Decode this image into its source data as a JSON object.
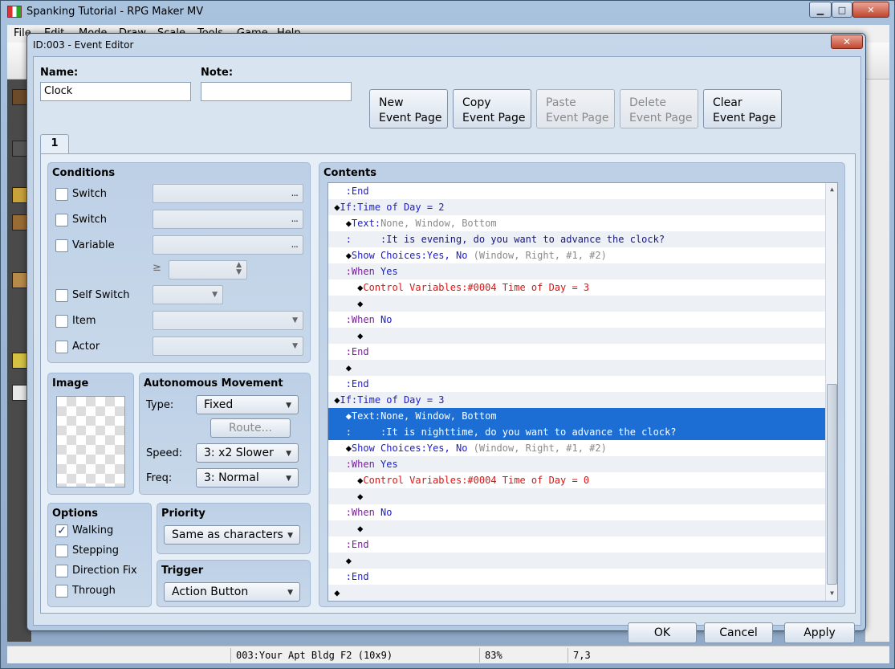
{
  "main_window": {
    "title": "Spanking Tutorial - RPG Maker MV",
    "menu": [
      "File",
      "Edit",
      "Mode",
      "Draw",
      "Scale",
      "Tools",
      "Game",
      "Help"
    ],
    "status": {
      "map": "003:Your Apt Bldg F2 (10x9)",
      "zoom": "83%",
      "coords": "7,3"
    }
  },
  "dialog": {
    "title": "ID:003 - Event Editor",
    "close_label": "x",
    "name_label": "Name:",
    "name_value": "Clock",
    "note_label": "Note:",
    "note_value": "",
    "page_buttons": {
      "new": [
        "New",
        "Event Page"
      ],
      "copy": [
        "Copy",
        "Event Page"
      ],
      "paste": [
        "Paste",
        "Event Page"
      ],
      "delete": [
        "Delete",
        "Event Page"
      ],
      "clear": [
        "Clear",
        "Event Page"
      ]
    },
    "tab_label": "1",
    "conditions": {
      "title": "Conditions",
      "switch1": "Switch",
      "switch2": "Switch",
      "variable": "Variable",
      "ge_symbol": "≥",
      "self_switch": "Self Switch",
      "item": "Item",
      "actor": "Actor",
      "dots": "..."
    },
    "image": {
      "title": "Image"
    },
    "autonomous": {
      "title": "Autonomous Movement",
      "type_label": "Type:",
      "type_value": "Fixed",
      "route_label": "Route...",
      "speed_label": "Speed:",
      "speed_value": "3: x2 Slower",
      "freq_label": "Freq:",
      "freq_value": "3: Normal"
    },
    "options": {
      "title": "Options",
      "walking": "Walking",
      "walking_checked": true,
      "stepping": "Stepping",
      "direction_fix": "Direction Fix",
      "through": "Through"
    },
    "priority": {
      "title": "Priority",
      "value": "Same as characters"
    },
    "trigger": {
      "title": "Trigger",
      "value": "Action Button"
    },
    "contents": {
      "title": "Contents",
      "rows": [
        {
          "indent": "  ",
          "parts": [
            [
              "c-blue",
              ":"
            ],
            [
              "c-blue",
              "End"
            ]
          ]
        },
        {
          "indent": "",
          "parts": [
            [
              "",
              "◆"
            ],
            [
              "c-blue",
              "If"
            ],
            [
              "c-blue",
              ":"
            ],
            [
              "c-blue",
              "Time of Day = 2"
            ]
          ]
        },
        {
          "indent": "  ",
          "parts": [
            [
              "",
              "◆"
            ],
            [
              "c-blue",
              "Text"
            ],
            [
              "c-blue",
              ":"
            ],
            [
              "c-gray",
              "None, Window, Bottom"
            ]
          ]
        },
        {
          "indent": "  ",
          "parts": [
            [
              "c-blue",
              ":"
            ],
            [
              "",
              "     "
            ],
            [
              "c-navy",
              ":"
            ],
            [
              "c-navy",
              "It is evening, do you want to advance the clock?"
            ]
          ]
        },
        {
          "indent": "  ",
          "parts": [
            [
              "",
              "◆"
            ],
            [
              "c-blue",
              "Show Choices"
            ],
            [
              "c-blue",
              ":"
            ],
            [
              "c-blue",
              "Yes, No"
            ],
            [
              "c-gray",
              " (Window, Right, #1, #2)"
            ]
          ]
        },
        {
          "indent": "  ",
          "parts": [
            [
              "c-purple",
              ":"
            ],
            [
              "c-purple",
              "When"
            ],
            [
              "c-blue",
              " Yes"
            ]
          ]
        },
        {
          "indent": "    ",
          "parts": [
            [
              "",
              "◆"
            ],
            [
              "c-red",
              "Control Variables"
            ],
            [
              "c-red",
              ":"
            ],
            [
              "c-red",
              "#0004 Time of Day = 3"
            ]
          ]
        },
        {
          "indent": "    ",
          "parts": [
            [
              "",
              "◆"
            ]
          ]
        },
        {
          "indent": "  ",
          "parts": [
            [
              "c-purple",
              ":"
            ],
            [
              "c-purple",
              "When"
            ],
            [
              "c-blue",
              " No"
            ]
          ]
        },
        {
          "indent": "    ",
          "parts": [
            [
              "",
              "◆"
            ]
          ]
        },
        {
          "indent": "  ",
          "parts": [
            [
              "c-purple",
              ":"
            ],
            [
              "c-purple",
              "End"
            ]
          ]
        },
        {
          "indent": "  ",
          "parts": [
            [
              "",
              "◆"
            ]
          ]
        },
        {
          "indent": "  ",
          "parts": [
            [
              "c-blue",
              ":"
            ],
            [
              "c-blue",
              "End"
            ]
          ]
        },
        {
          "indent": "",
          "parts": [
            [
              "",
              "◆"
            ],
            [
              "c-blue",
              "If"
            ],
            [
              "c-blue",
              ":"
            ],
            [
              "c-blue",
              "Time of Day = 3"
            ]
          ]
        },
        {
          "indent": "  ",
          "selected": true,
          "parts": [
            [
              "",
              "◆"
            ],
            [
              "c-blue",
              "Text"
            ],
            [
              "c-blue",
              ":"
            ],
            [
              "c-gray",
              "None, Window, Bottom"
            ]
          ]
        },
        {
          "indent": "  ",
          "selected": true,
          "parts": [
            [
              "c-blue",
              ":"
            ],
            [
              "",
              "     "
            ],
            [
              "c-navy",
              ":"
            ],
            [
              "c-navy",
              "It is nighttime, do you want to advance the clock?"
            ]
          ]
        },
        {
          "indent": "  ",
          "parts": [
            [
              "",
              "◆"
            ],
            [
              "c-blue",
              "Show Choices"
            ],
            [
              "c-blue",
              ":"
            ],
            [
              "c-blue",
              "Yes, No"
            ],
            [
              "c-gray",
              " (Window, Right, #1, #2)"
            ]
          ]
        },
        {
          "indent": "  ",
          "parts": [
            [
              "c-purple",
              ":"
            ],
            [
              "c-purple",
              "When"
            ],
            [
              "c-blue",
              " Yes"
            ]
          ]
        },
        {
          "indent": "    ",
          "parts": [
            [
              "",
              "◆"
            ],
            [
              "c-red",
              "Control Variables"
            ],
            [
              "c-red",
              ":"
            ],
            [
              "c-red",
              "#0004 Time of Day = 0"
            ]
          ]
        },
        {
          "indent": "    ",
          "parts": [
            [
              "",
              "◆"
            ]
          ]
        },
        {
          "indent": "  ",
          "parts": [
            [
              "c-purple",
              ":"
            ],
            [
              "c-purple",
              "When"
            ],
            [
              "c-blue",
              " No"
            ]
          ]
        },
        {
          "indent": "    ",
          "parts": [
            [
              "",
              "◆"
            ]
          ]
        },
        {
          "indent": "  ",
          "parts": [
            [
              "c-purple",
              ":"
            ],
            [
              "c-purple",
              "End"
            ]
          ]
        },
        {
          "indent": "  ",
          "parts": [
            [
              "",
              "◆"
            ]
          ]
        },
        {
          "indent": "  ",
          "parts": [
            [
              "c-blue",
              ":"
            ],
            [
              "c-blue",
              "End"
            ]
          ]
        },
        {
          "indent": "",
          "parts": [
            [
              "",
              "◆"
            ]
          ]
        }
      ]
    },
    "footer": {
      "ok": "OK",
      "cancel": "Cancel",
      "apply": "Apply"
    }
  }
}
